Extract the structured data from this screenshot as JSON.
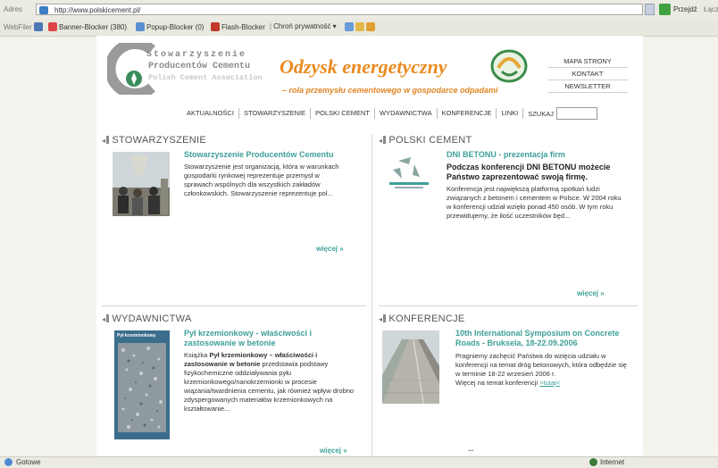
{
  "browser": {
    "address_label": "Adres",
    "url": "http://www.polskicement.pl/",
    "go_label": "Przejdź",
    "links_label": "Łącza",
    "toolbar_label": "WebFiler",
    "toolbar_items": [
      "Banner-Blocker (380)",
      "Popup-Blocker (0)",
      "Flash-Blocker",
      "Chroń prywatność"
    ],
    "status_left": "Gotowe",
    "status_right": "Internet"
  },
  "site": {
    "org_lines": [
      "Stowarzyszenie",
      "Producentów Cementu",
      "Polish Cement Association"
    ],
    "banner_title": "Odzysk energetyczny",
    "banner_subtitle": "– rola przemysłu cementowego w gospodarce odpadami",
    "top_links": [
      "MAPA STRONY",
      "KONTAKT",
      "NEWSLETTER"
    ],
    "nav": [
      "AKTUALNOŚCI",
      "STOWARZYSZENIE",
      "POLSKI CEMENT",
      "WYDAWNICTWA",
      "KONFERENCJE",
      "LINKI"
    ],
    "search_label": "SZUKAJ"
  },
  "sections": {
    "stowarzyszenie": {
      "heading": "STOWARZYSZENIE",
      "headline": "Stowarzyszenie Producentów Cementu",
      "body": "Stowarzyszenie jest organizacją, która w warunkach gospodarki rynkowej reprezentuje przemysł w sprawach wspólnych dla wszystkich zakładów członkowskich. Stowarzyszenie reprezentuje pol...",
      "more": "więcej »"
    },
    "polski_cement": {
      "heading": "POLSKI CEMENT",
      "headline": "DNI BETONU - prezentacja firm",
      "lead": "Podczas konferencji DNI BETONU możecie Państwo zaprezentować swoją firmę.",
      "body": "Konferencja jest największą platformą spotkań ludzi związanych z betonem i cementem w Polsce. W 2004 roku w konferencji udział wzięło ponad 450 osób. W tym roku przewidujemy, że ilość uczestników będ...",
      "more": "więcej »"
    },
    "wydawnictwa": {
      "heading": "WYDAWNICTWA",
      "headline": "Pył krzemionkowy - właściwości i zastosowanie w betonie",
      "body_pre": "Książka ",
      "body_bold": "Pył krzemionkowy – właściwości i zastosowanie w betonie",
      "body_post": " przedstawia podstawy fizykochemiczne oddziaływania pyłu krzemionkowego/nanokrzemionki w procesie wiązania/twardnienia cementu, jak również wpływ drobno zdyspergowanych materiałów krzemionkowych na kształtowanie...",
      "more": "więcej »",
      "book_title": "Pył krzemionkowy"
    },
    "konferencje": {
      "heading": "KONFERENCJE",
      "headline": "10th International Symposium on Concrete Roads - Bruksela, 18-22.09.2006",
      "body": "Pragniemy zachęcić Państwa do wzięcia udziału w konferencji na temat dróg betonowych, która odbędzie się w terminie 18-22 wrzesień 2006 r.",
      "more_pre": "Więcej na temat konferencji ",
      "more_link": ">tutaj<",
      "ellipsis": "..."
    }
  },
  "colors": {
    "accent_teal": "#3d9f97",
    "banner_orange": "#ea8a1e"
  }
}
